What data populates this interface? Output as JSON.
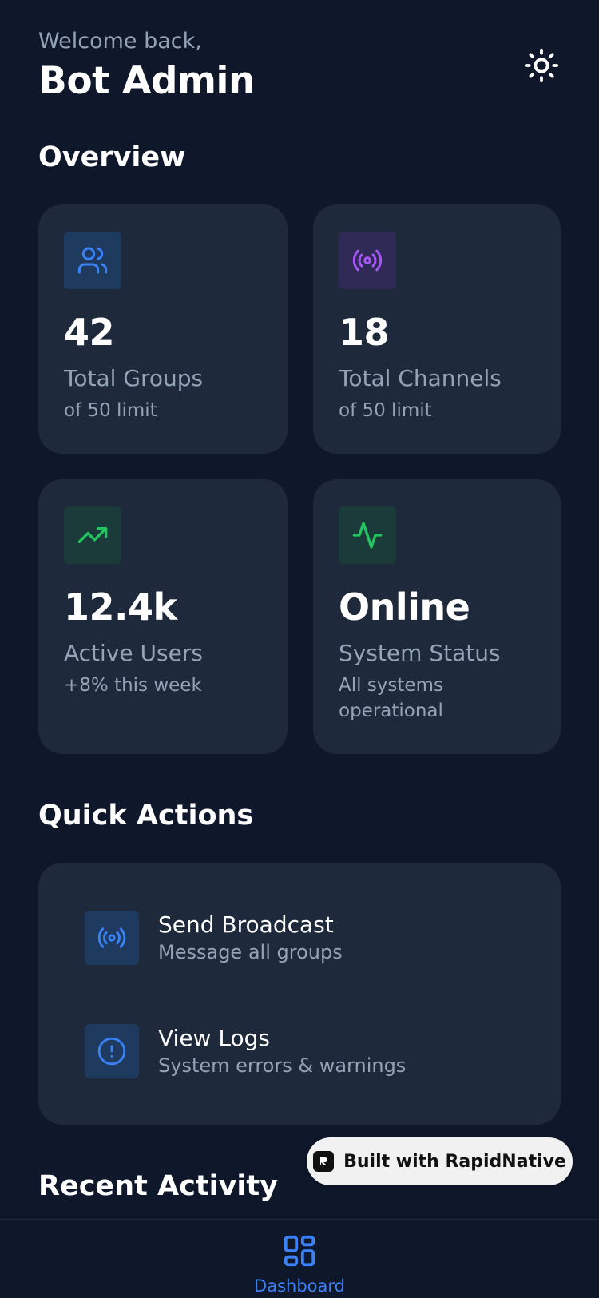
{
  "header": {
    "welcome": "Welcome back,",
    "username": "Bot Admin",
    "theme_icon": "sun-icon"
  },
  "overview": {
    "title": "Overview",
    "cards": [
      {
        "icon": "users-icon",
        "icon_color": "#3b82f6",
        "value": "42",
        "label": "Total Groups",
        "sub": "of 50 limit"
      },
      {
        "icon": "broadcast-icon",
        "icon_color": "#a855f7",
        "value": "18",
        "label": "Total Channels",
        "sub": "of 50 limit"
      },
      {
        "icon": "trending-up-icon",
        "icon_color": "#22c55e",
        "value": "12.4k",
        "label": "Active Users",
        "sub": "+8% this week"
      },
      {
        "icon": "activity-icon",
        "icon_color": "#22c55e",
        "value": "Online",
        "label": "System Status",
        "sub": "All systems operational"
      }
    ]
  },
  "quick_actions": {
    "title": "Quick Actions",
    "items": [
      {
        "icon": "broadcast-icon",
        "title": "Send Broadcast",
        "subtitle": "Message all groups"
      },
      {
        "icon": "alert-circle-icon",
        "title": "View Logs",
        "subtitle": "System errors & warnings"
      }
    ]
  },
  "recent_activity": {
    "title": "Recent Activity"
  },
  "badge": {
    "text": "Built with RapidNative"
  },
  "tabbar": {
    "items": [
      {
        "label": "Dashboard",
        "icon": "dashboard-icon",
        "active": true
      }
    ]
  },
  "colors": {
    "background": "#0f172a",
    "card": "#1e293b",
    "accent": "#3b82f6",
    "muted_text": "#94a3b8"
  }
}
